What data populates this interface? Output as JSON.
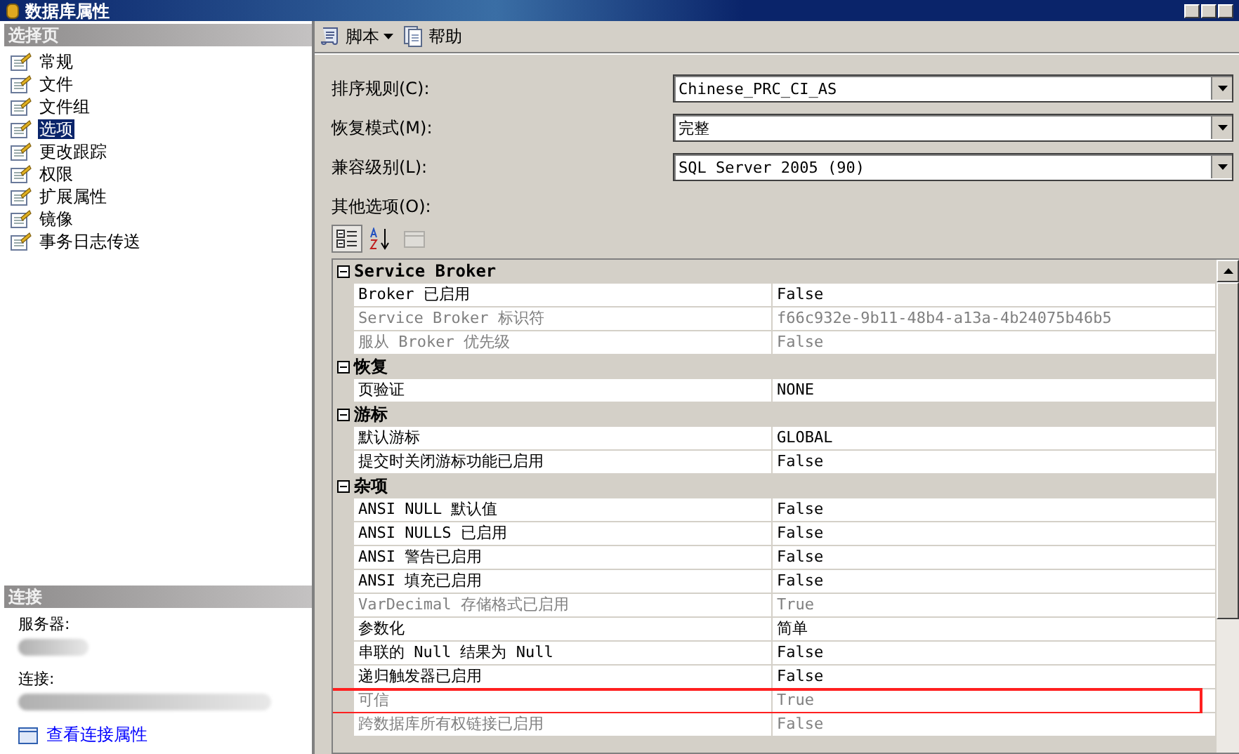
{
  "window": {
    "title": "数据库属性"
  },
  "sidebar": {
    "header": "选择页",
    "items": [
      {
        "label": "常规",
        "selected": false
      },
      {
        "label": "文件",
        "selected": false
      },
      {
        "label": "文件组",
        "selected": false
      },
      {
        "label": "选项",
        "selected": true
      },
      {
        "label": "更改跟踪",
        "selected": false
      },
      {
        "label": "权限",
        "selected": false
      },
      {
        "label": "扩展属性",
        "selected": false
      },
      {
        "label": "镜像",
        "selected": false
      },
      {
        "label": "事务日志传送",
        "selected": false
      }
    ]
  },
  "connection": {
    "header": "连接",
    "server_label": "服务器:",
    "connection_label": "连接:",
    "link": "查看连接属性"
  },
  "toolbar": {
    "items": [
      {
        "label": "脚本",
        "kind": "dropdown"
      },
      {
        "label": "帮助",
        "kind": "help"
      }
    ]
  },
  "fields": [
    {
      "label": "排序规则(C):",
      "value": "Chinese_PRC_CI_AS"
    },
    {
      "label": "恢复模式(M):",
      "value": "完整"
    },
    {
      "label": "兼容级别(L):",
      "value": "SQL Server 2005 (90)"
    }
  ],
  "other_options": {
    "label": "其他选项(O):",
    "view_buttons": [
      {
        "kind": "categorized",
        "selected": true
      },
      {
        "kind": "alphabetical",
        "selected": false
      },
      {
        "kind": "pages",
        "selected": false,
        "disabled": true
      }
    ]
  },
  "property_grid": {
    "rows": [
      {
        "kind": "category",
        "name": "Service Broker",
        "expanded": true
      },
      {
        "kind": "property",
        "name": "Broker 已启用",
        "value": "False",
        "disabled": false,
        "highlighted": false
      },
      {
        "kind": "property",
        "name": "Service Broker 标识符",
        "value": "f66c932e-9b11-48b4-a13a-4b24075b46b5",
        "disabled": true,
        "highlighted": false
      },
      {
        "kind": "property",
        "name": "服从 Broker 优先级",
        "value": "False",
        "disabled": true,
        "highlighted": false
      },
      {
        "kind": "category",
        "name": "恢复",
        "expanded": true
      },
      {
        "kind": "property",
        "name": "页验证",
        "value": "NONE",
        "disabled": false,
        "highlighted": false
      },
      {
        "kind": "category",
        "name": "游标",
        "expanded": true
      },
      {
        "kind": "property",
        "name": "默认游标",
        "value": "GLOBAL",
        "disabled": false,
        "highlighted": false
      },
      {
        "kind": "property",
        "name": "提交时关闭游标功能已启用",
        "value": "False",
        "disabled": false,
        "highlighted": false
      },
      {
        "kind": "category",
        "name": "杂项",
        "expanded": true
      },
      {
        "kind": "property",
        "name": "ANSI NULL 默认值",
        "value": "False",
        "disabled": false,
        "highlighted": false
      },
      {
        "kind": "property",
        "name": "ANSI NULLS 已启用",
        "value": "False",
        "disabled": false,
        "highlighted": false
      },
      {
        "kind": "property",
        "name": "ANSI 警告已启用",
        "value": "False",
        "disabled": false,
        "highlighted": false
      },
      {
        "kind": "property",
        "name": "ANSI 填充已启用",
        "value": "False",
        "disabled": false,
        "highlighted": false
      },
      {
        "kind": "property",
        "name": "VarDecimal 存储格式已启用",
        "value": "True",
        "disabled": true,
        "highlighted": false
      },
      {
        "kind": "property",
        "name": "参数化",
        "value": "简单",
        "disabled": false,
        "highlighted": false
      },
      {
        "kind": "property",
        "name": "串联的 Null 结果为 Null",
        "value": "False",
        "disabled": false,
        "highlighted": false
      },
      {
        "kind": "property",
        "name": "递归触发器已启用",
        "value": "False",
        "disabled": false,
        "highlighted": false
      },
      {
        "kind": "property",
        "name": "可信",
        "value": "True",
        "disabled": true,
        "highlighted": true
      },
      {
        "kind": "property",
        "name": "跨数据库所有权链接已启用",
        "value": "False",
        "disabled": true,
        "highlighted": false
      }
    ]
  }
}
